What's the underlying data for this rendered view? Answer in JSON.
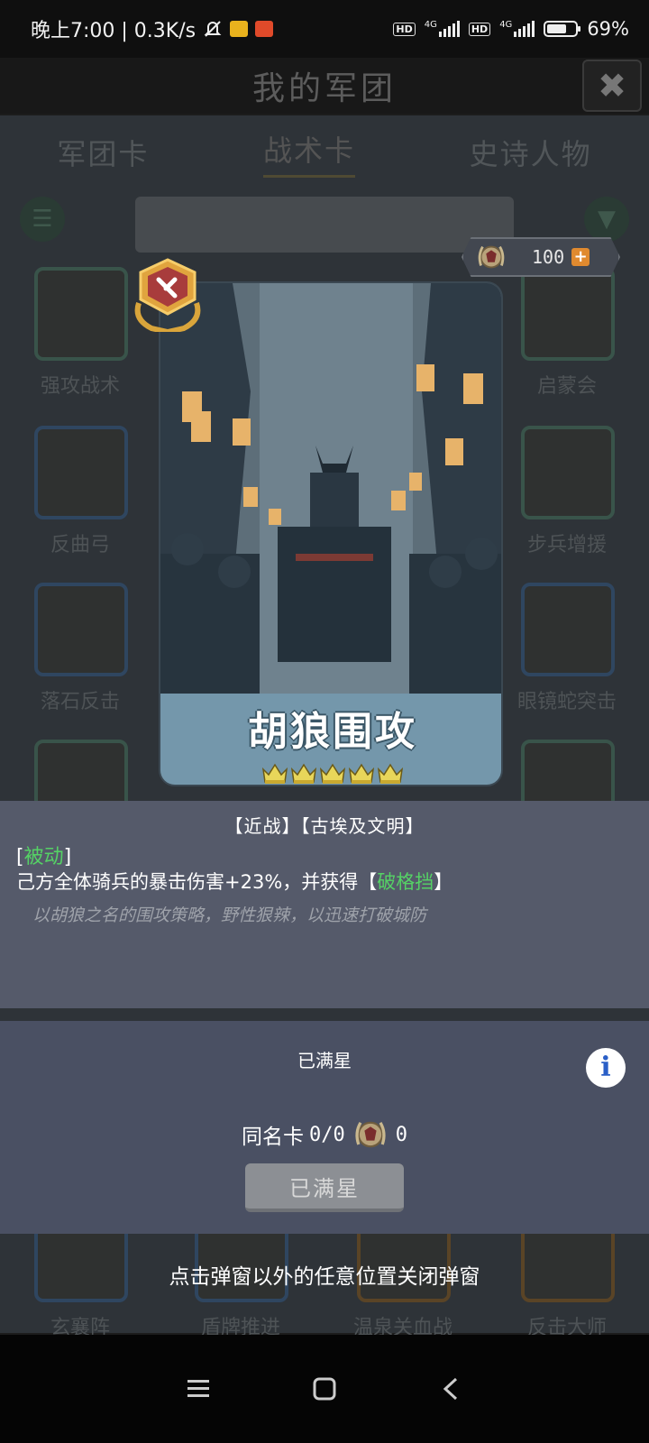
{
  "status_bar": {
    "time_speed": "晚上7:00 | 0.3K/s",
    "sim1_type": "4G",
    "sim2_type": "4G",
    "hd1": "HD",
    "hd2": "HD",
    "battery_percent": "69%",
    "battery_level": 0.69,
    "icons": [
      "mute-bell-icon",
      "mail-app-icon",
      "listen-app-icon",
      "signal-icon",
      "battery-icon"
    ]
  },
  "header": {
    "title": "我的军团",
    "close_icon": "close-icon"
  },
  "tabs": [
    {
      "label": "军团卡"
    },
    {
      "label": "战术卡"
    },
    {
      "label": "史诗人物"
    }
  ],
  "grid_labels": {
    "r1c1": "强攻战术",
    "r1c4": "启蒙会",
    "r2c1": "反曲弓",
    "r2c4": "步兵增援",
    "r3c1": "落石反击",
    "r3c4": "眼镜蛇突击",
    "r7c1": "玄襄阵",
    "r7c2": "盾牌推进",
    "r7c3": "温泉关血战",
    "r7c4": "反击大师"
  },
  "tokens": {
    "count": "100",
    "plus": "+"
  },
  "card": {
    "name": "胡狼围攻",
    "stars": 5,
    "badge_icon": "shield-sword-badge-icon"
  },
  "description": {
    "tags": "【近战】【古埃及文明】",
    "passive_open": "[",
    "passive_label": "被动",
    "passive_close": "]",
    "effect_text": "己方全体骑兵的暴击伤害+23%，并获得【",
    "effect_keyword": "破格挡",
    "effect_close": "】",
    "flavor": "以胡狼之名的围攻策略，野性狠辣，以迅速打破城防"
  },
  "star_panel": {
    "status": "已满星",
    "duplicate_label": "同名卡",
    "duplicate_count": "0/0",
    "token_count": "0",
    "button_label": "已满星",
    "info_icon": "i"
  },
  "hint": "点击弹窗以外的任意位置关闭弹窗",
  "nav": [
    "menu-icon",
    "home-icon",
    "back-icon"
  ],
  "colors": {
    "accent_green": "#55d265",
    "plus_orange": "#e08a2f",
    "crown_gold": "#e8d65a"
  }
}
